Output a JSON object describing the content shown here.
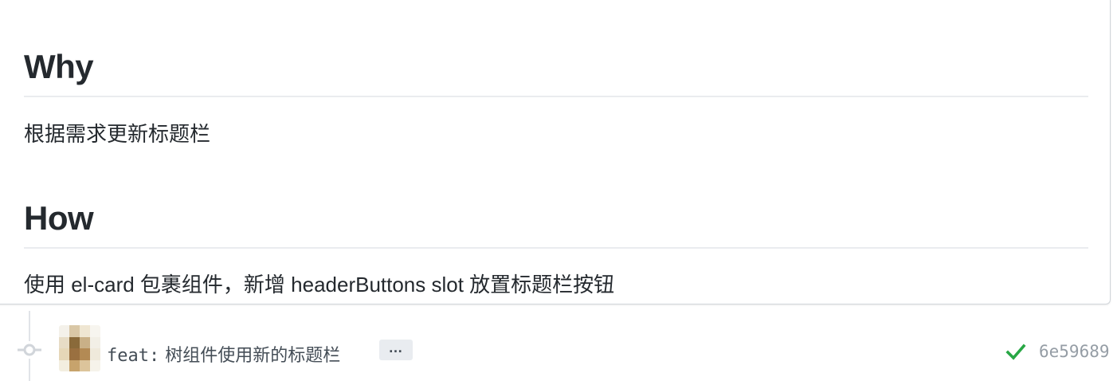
{
  "comment": {
    "sections": [
      {
        "heading": "Why",
        "body": "根据需求更新标题栏"
      },
      {
        "heading": "How",
        "body": "使用 el-card 包裹组件，新增 headerButtons slot 放置标题栏按钮"
      }
    ]
  },
  "commit": {
    "message_prefix": "feat:",
    "message_text": " 树组件使用新的标题栏",
    "expand_label": "…",
    "status_icon": "check-icon",
    "status_color": "#28a745",
    "sha": "6e59689"
  },
  "colors": {
    "text": "#24292e",
    "muted": "#959da5",
    "border": "#eaecef"
  }
}
